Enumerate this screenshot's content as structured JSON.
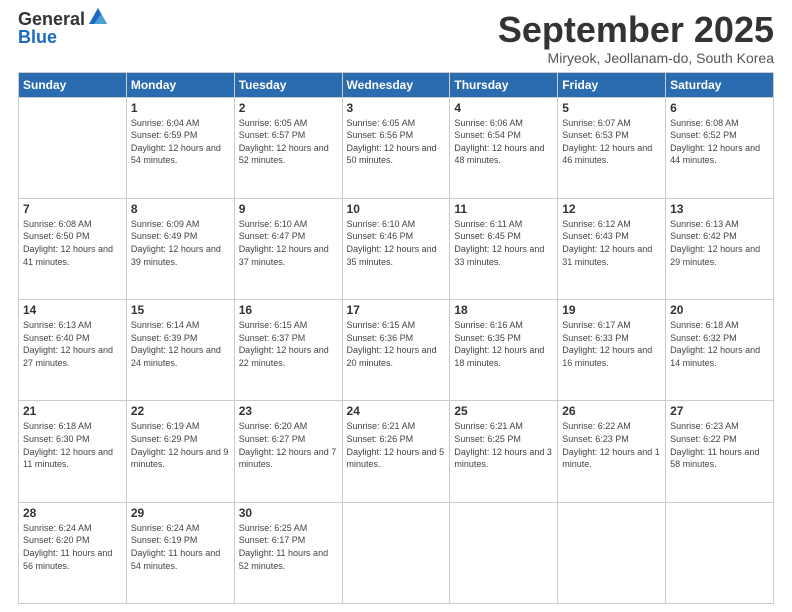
{
  "logo": {
    "general": "General",
    "blue": "Blue"
  },
  "header": {
    "month": "September 2025",
    "location": "Miryeok, Jeollanam-do, South Korea"
  },
  "days": [
    "Sunday",
    "Monday",
    "Tuesday",
    "Wednesday",
    "Thursday",
    "Friday",
    "Saturday"
  ],
  "weeks": [
    [
      {
        "day": "",
        "sunrise": "",
        "sunset": "",
        "daylight": ""
      },
      {
        "day": "1",
        "sunrise": "Sunrise: 6:04 AM",
        "sunset": "Sunset: 6:59 PM",
        "daylight": "Daylight: 12 hours and 54 minutes."
      },
      {
        "day": "2",
        "sunrise": "Sunrise: 6:05 AM",
        "sunset": "Sunset: 6:57 PM",
        "daylight": "Daylight: 12 hours and 52 minutes."
      },
      {
        "day": "3",
        "sunrise": "Sunrise: 6:05 AM",
        "sunset": "Sunset: 6:56 PM",
        "daylight": "Daylight: 12 hours and 50 minutes."
      },
      {
        "day": "4",
        "sunrise": "Sunrise: 6:06 AM",
        "sunset": "Sunset: 6:54 PM",
        "daylight": "Daylight: 12 hours and 48 minutes."
      },
      {
        "day": "5",
        "sunrise": "Sunrise: 6:07 AM",
        "sunset": "Sunset: 6:53 PM",
        "daylight": "Daylight: 12 hours and 46 minutes."
      },
      {
        "day": "6",
        "sunrise": "Sunrise: 6:08 AM",
        "sunset": "Sunset: 6:52 PM",
        "daylight": "Daylight: 12 hours and 44 minutes."
      }
    ],
    [
      {
        "day": "7",
        "sunrise": "Sunrise: 6:08 AM",
        "sunset": "Sunset: 6:50 PM",
        "daylight": "Daylight: 12 hours and 41 minutes."
      },
      {
        "day": "8",
        "sunrise": "Sunrise: 6:09 AM",
        "sunset": "Sunset: 6:49 PM",
        "daylight": "Daylight: 12 hours and 39 minutes."
      },
      {
        "day": "9",
        "sunrise": "Sunrise: 6:10 AM",
        "sunset": "Sunset: 6:47 PM",
        "daylight": "Daylight: 12 hours and 37 minutes."
      },
      {
        "day": "10",
        "sunrise": "Sunrise: 6:10 AM",
        "sunset": "Sunset: 6:46 PM",
        "daylight": "Daylight: 12 hours and 35 minutes."
      },
      {
        "day": "11",
        "sunrise": "Sunrise: 6:11 AM",
        "sunset": "Sunset: 6:45 PM",
        "daylight": "Daylight: 12 hours and 33 minutes."
      },
      {
        "day": "12",
        "sunrise": "Sunrise: 6:12 AM",
        "sunset": "Sunset: 6:43 PM",
        "daylight": "Daylight: 12 hours and 31 minutes."
      },
      {
        "day": "13",
        "sunrise": "Sunrise: 6:13 AM",
        "sunset": "Sunset: 6:42 PM",
        "daylight": "Daylight: 12 hours and 29 minutes."
      }
    ],
    [
      {
        "day": "14",
        "sunrise": "Sunrise: 6:13 AM",
        "sunset": "Sunset: 6:40 PM",
        "daylight": "Daylight: 12 hours and 27 minutes."
      },
      {
        "day": "15",
        "sunrise": "Sunrise: 6:14 AM",
        "sunset": "Sunset: 6:39 PM",
        "daylight": "Daylight: 12 hours and 24 minutes."
      },
      {
        "day": "16",
        "sunrise": "Sunrise: 6:15 AM",
        "sunset": "Sunset: 6:37 PM",
        "daylight": "Daylight: 12 hours and 22 minutes."
      },
      {
        "day": "17",
        "sunrise": "Sunrise: 6:15 AM",
        "sunset": "Sunset: 6:36 PM",
        "daylight": "Daylight: 12 hours and 20 minutes."
      },
      {
        "day": "18",
        "sunrise": "Sunrise: 6:16 AM",
        "sunset": "Sunset: 6:35 PM",
        "daylight": "Daylight: 12 hours and 18 minutes."
      },
      {
        "day": "19",
        "sunrise": "Sunrise: 6:17 AM",
        "sunset": "Sunset: 6:33 PM",
        "daylight": "Daylight: 12 hours and 16 minutes."
      },
      {
        "day": "20",
        "sunrise": "Sunrise: 6:18 AM",
        "sunset": "Sunset: 6:32 PM",
        "daylight": "Daylight: 12 hours and 14 minutes."
      }
    ],
    [
      {
        "day": "21",
        "sunrise": "Sunrise: 6:18 AM",
        "sunset": "Sunset: 6:30 PM",
        "daylight": "Daylight: 12 hours and 11 minutes."
      },
      {
        "day": "22",
        "sunrise": "Sunrise: 6:19 AM",
        "sunset": "Sunset: 6:29 PM",
        "daylight": "Daylight: 12 hours and 9 minutes."
      },
      {
        "day": "23",
        "sunrise": "Sunrise: 6:20 AM",
        "sunset": "Sunset: 6:27 PM",
        "daylight": "Daylight: 12 hours and 7 minutes."
      },
      {
        "day": "24",
        "sunrise": "Sunrise: 6:21 AM",
        "sunset": "Sunset: 6:26 PM",
        "daylight": "Daylight: 12 hours and 5 minutes."
      },
      {
        "day": "25",
        "sunrise": "Sunrise: 6:21 AM",
        "sunset": "Sunset: 6:25 PM",
        "daylight": "Daylight: 12 hours and 3 minutes."
      },
      {
        "day": "26",
        "sunrise": "Sunrise: 6:22 AM",
        "sunset": "Sunset: 6:23 PM",
        "daylight": "Daylight: 12 hours and 1 minute."
      },
      {
        "day": "27",
        "sunrise": "Sunrise: 6:23 AM",
        "sunset": "Sunset: 6:22 PM",
        "daylight": "Daylight: 11 hours and 58 minutes."
      }
    ],
    [
      {
        "day": "28",
        "sunrise": "Sunrise: 6:24 AM",
        "sunset": "Sunset: 6:20 PM",
        "daylight": "Daylight: 11 hours and 56 minutes."
      },
      {
        "day": "29",
        "sunrise": "Sunrise: 6:24 AM",
        "sunset": "Sunset: 6:19 PM",
        "daylight": "Daylight: 11 hours and 54 minutes."
      },
      {
        "day": "30",
        "sunrise": "Sunrise: 6:25 AM",
        "sunset": "Sunset: 6:17 PM",
        "daylight": "Daylight: 11 hours and 52 minutes."
      },
      {
        "day": "",
        "sunrise": "",
        "sunset": "",
        "daylight": ""
      },
      {
        "day": "",
        "sunrise": "",
        "sunset": "",
        "daylight": ""
      },
      {
        "day": "",
        "sunrise": "",
        "sunset": "",
        "daylight": ""
      },
      {
        "day": "",
        "sunrise": "",
        "sunset": "",
        "daylight": ""
      }
    ]
  ]
}
